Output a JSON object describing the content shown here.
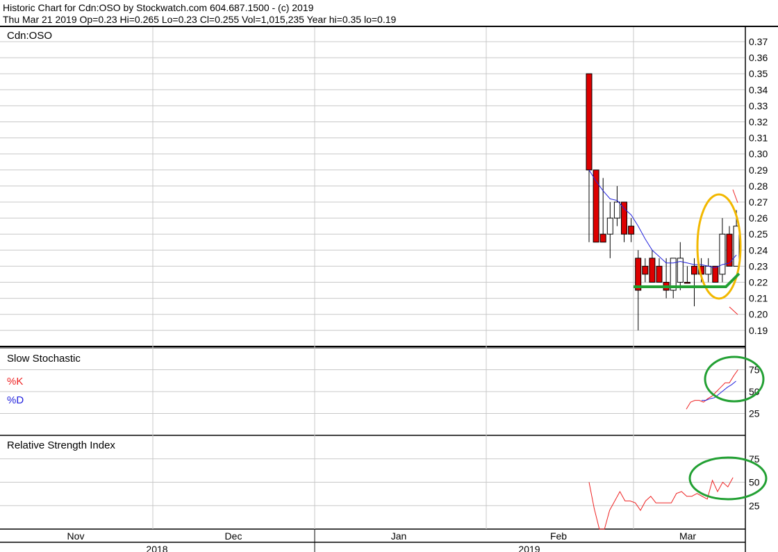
{
  "header": {
    "line1": "Historic Chart for Cdn:OSO by Stockwatch.com 604.687.1500 - (c) 2019",
    "line2": "Thu Mar 21 2019   Op=0.23   Hi=0.265   Lo=0.23   Cl=0.255   Vol=1,015,235   Year hi=0.35   lo=0.19"
  },
  "colors": {
    "up_candle": "#ffffff",
    "down_candle": "#dd0000",
    "ma_line": "#2222dd",
    "k_line": "#ee2222",
    "d_line": "#2222dd",
    "rsi_line": "#ee2222",
    "annotation_yellow": "#f2b800",
    "annotation_green": "#22a033",
    "grid": "#c8c8c8"
  },
  "chart_data": [
    {
      "type": "candlestick",
      "title": "Cdn:OSO",
      "ylim": [
        0.185,
        0.375
      ],
      "y_ticks": [
        "0.37",
        "0.36",
        "0.35",
        "0.34",
        "0.33",
        "0.32",
        "0.31",
        "0.30",
        "0.29",
        "0.28",
        "0.27",
        "0.26",
        "0.25",
        "0.24",
        "0.23",
        "0.22",
        "0.21",
        "0.20",
        "0.19"
      ],
      "months": [
        "Nov",
        "Dec",
        "Jan",
        "Feb",
        "Mar"
      ],
      "years": [
        "2018",
        "2019"
      ],
      "candles": [
        {
          "o": 0.35,
          "h": 0.35,
          "l": 0.245,
          "c": 0.29
        },
        {
          "o": 0.29,
          "h": 0.29,
          "l": 0.245,
          "c": 0.245
        },
        {
          "o": 0.25,
          "h": 0.285,
          "l": 0.245,
          "c": 0.245
        },
        {
          "o": 0.25,
          "h": 0.27,
          "l": 0.235,
          "c": 0.26
        },
        {
          "o": 0.26,
          "h": 0.28,
          "l": 0.255,
          "c": 0.27
        },
        {
          "o": 0.27,
          "h": 0.27,
          "l": 0.245,
          "c": 0.25
        },
        {
          "o": 0.255,
          "h": 0.26,
          "l": 0.245,
          "c": 0.25
        },
        {
          "o": 0.235,
          "h": 0.24,
          "l": 0.19,
          "c": 0.215
        },
        {
          "o": 0.23,
          "h": 0.235,
          "l": 0.22,
          "c": 0.225
        },
        {
          "o": 0.235,
          "h": 0.24,
          "l": 0.22,
          "c": 0.22
        },
        {
          "o": 0.23,
          "h": 0.235,
          "l": 0.22,
          "c": 0.22
        },
        {
          "o": 0.22,
          "h": 0.235,
          "l": 0.21,
          "c": 0.215
        },
        {
          "o": 0.215,
          "h": 0.235,
          "l": 0.21,
          "c": 0.235
        },
        {
          "o": 0.22,
          "h": 0.245,
          "l": 0.215,
          "c": 0.235
        },
        {
          "o": 0.22,
          "h": 0.23,
          "l": 0.22,
          "c": 0.22
        },
        {
          "o": 0.23,
          "h": 0.235,
          "l": 0.205,
          "c": 0.225
        },
        {
          "o": 0.23,
          "h": 0.235,
          "l": 0.22,
          "c": 0.225
        },
        {
          "o": 0.225,
          "h": 0.235,
          "l": 0.22,
          "c": 0.23
        },
        {
          "o": 0.23,
          "h": 0.23,
          "l": 0.22,
          "c": 0.22
        },
        {
          "o": 0.225,
          "h": 0.26,
          "l": 0.22,
          "c": 0.25
        },
        {
          "o": 0.25,
          "h": 0.255,
          "l": 0.23,
          "c": 0.23
        },
        {
          "o": 0.23,
          "h": 0.265,
          "l": 0.23,
          "c": 0.255
        }
      ],
      "moving_average": [
        0.29,
        0.283,
        0.277,
        0.272,
        0.271,
        0.266,
        0.262,
        0.255,
        0.247,
        0.24,
        0.236,
        0.232,
        0.232,
        0.233,
        0.232,
        0.231,
        0.231,
        0.23,
        0.229,
        0.231,
        0.232,
        0.237
      ]
    },
    {
      "type": "line",
      "title": "Slow Stochastic",
      "ylim": [
        0,
        100
      ],
      "y_ticks": [
        "75",
        "50",
        "25"
      ],
      "series": [
        {
          "name": "%K",
          "values": [
            30,
            38,
            40,
            40,
            38,
            42,
            45,
            50,
            55,
            60,
            60,
            68,
            75
          ]
        },
        {
          "name": "%D",
          "values": [
            40,
            40,
            42,
            43,
            47,
            51,
            55,
            58,
            62
          ]
        }
      ]
    },
    {
      "type": "line",
      "title": "Relative Strength Index",
      "ylim": [
        0,
        100
      ],
      "y_ticks": [
        "75",
        "50",
        "25"
      ],
      "series": [
        {
          "name": "RSI",
          "values": [
            50,
            22,
            0,
            0,
            20,
            30,
            40,
            30,
            30,
            28,
            20,
            30,
            35,
            28,
            28,
            28,
            28,
            38,
            40,
            35,
            35,
            38,
            35,
            32,
            52,
            40,
            50,
            45,
            55
          ]
        }
      ]
    }
  ]
}
